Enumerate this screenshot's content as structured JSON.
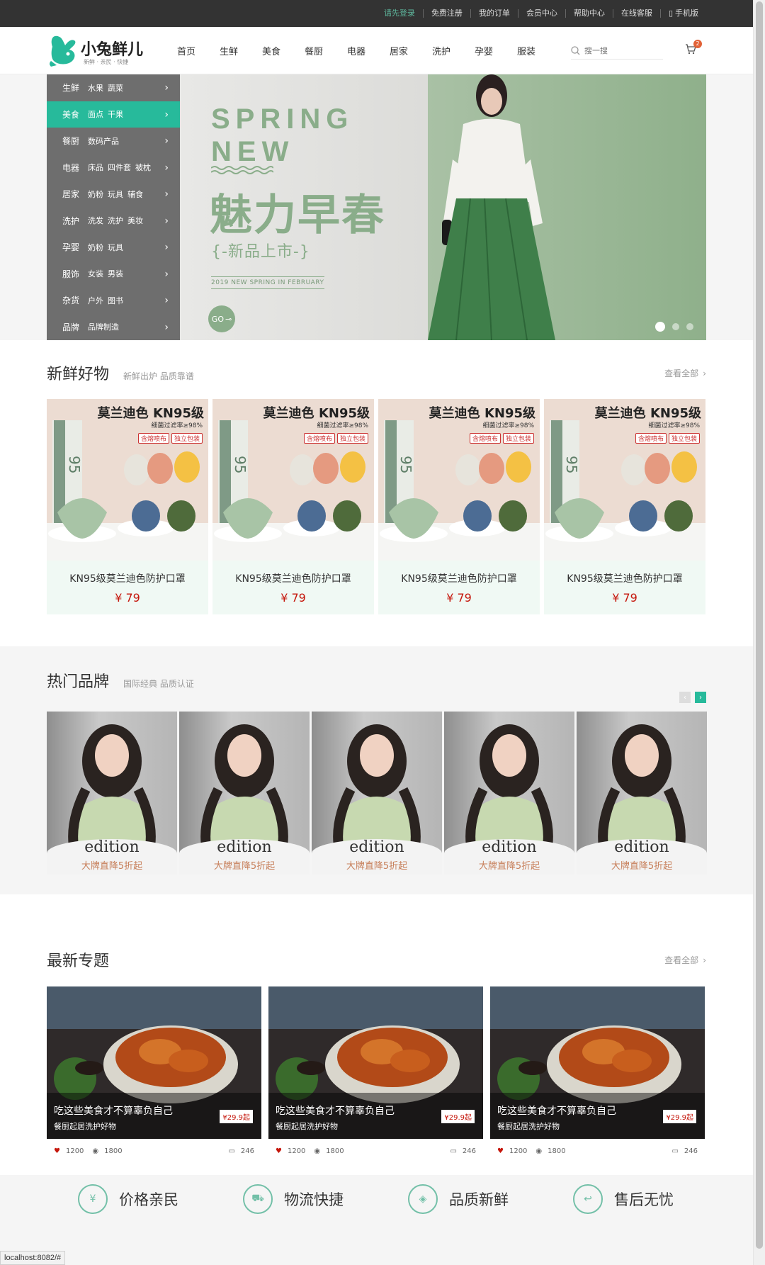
{
  "topbar": {
    "links": [
      {
        "label": "请先登录"
      },
      {
        "label": "免费注册"
      },
      {
        "label": "我的订单"
      },
      {
        "label": "会员中心"
      },
      {
        "label": "帮助中心"
      },
      {
        "label": "在线客服"
      },
      {
        "label": "手机版"
      }
    ]
  },
  "header": {
    "logo_text": "小兔鲜儿",
    "logo_slogan": "新鲜 · 亲民 · 快捷",
    "nav": [
      "首页",
      "生鲜",
      "美食",
      "餐厨",
      "电器",
      "居家",
      "洗护",
      "孕婴",
      "服装"
    ],
    "search_placeholder": "搜一搜",
    "cart_count": "2"
  },
  "categories": [
    {
      "main": "生鲜",
      "subs": [
        "水果",
        "蔬菜"
      ]
    },
    {
      "main": "美食",
      "subs": [
        "面点",
        "干果"
      ]
    },
    {
      "main": "餐厨",
      "subs": [
        "数码产品"
      ]
    },
    {
      "main": "电器",
      "subs": [
        "床品",
        "四件套",
        "被枕"
      ]
    },
    {
      "main": "居家",
      "subs": [
        "奶粉",
        "玩具",
        "辅食"
      ]
    },
    {
      "main": "洗护",
      "subs": [
        "洗发",
        "洗护",
        "美妆"
      ]
    },
    {
      "main": "孕婴",
      "subs": [
        "奶粉",
        "玩具"
      ]
    },
    {
      "main": "服饰",
      "subs": [
        "女装",
        "男装"
      ]
    },
    {
      "main": "杂货",
      "subs": [
        "户外",
        "图书"
      ]
    },
    {
      "main": "品牌",
      "subs": [
        "品牌制造"
      ]
    }
  ],
  "banner": {
    "line1": "SPRING",
    "line2": "NEW",
    "headline": "魅力早春",
    "tagline": "{-新品上市-}",
    "small": "2019 NEW SPRING IN FEBRUARY",
    "go": "GO"
  },
  "fresh": {
    "title": "新鲜好物",
    "subtitle": "新鲜出炉 品质靠谱",
    "more": "查看全部",
    "product_img_title": "莫兰迪色 KN95级",
    "product_img_sub": "细菌过滤率≥98%",
    "product_img_tag1": "含熔喷布",
    "product_img_tag2": "独立包装",
    "items": [
      {
        "name": "KN95级莫兰迪色防护口罩",
        "price": "¥ 79"
      },
      {
        "name": "KN95级莫兰迪色防护口罩",
        "price": "¥ 79"
      },
      {
        "name": "KN95级莫兰迪色防护口罩",
        "price": "¥ 79"
      },
      {
        "name": "KN95级莫兰迪色防护口罩",
        "price": "¥ 79"
      }
    ]
  },
  "brands": {
    "title": "热门品牌",
    "subtitle": "国际经典 品质认证",
    "items": [
      {
        "logo": "edition",
        "tag": "大牌直降5折起"
      },
      {
        "logo": "edition",
        "tag": "大牌直降5折起"
      },
      {
        "logo": "edition",
        "tag": "大牌直降5折起"
      },
      {
        "logo": "edition",
        "tag": "大牌直降5折起"
      },
      {
        "logo": "edition",
        "tag": "大牌直降5折起"
      }
    ]
  },
  "topics": {
    "title": "最新专题",
    "more": "查看全部",
    "items": [
      {
        "title": "吃这些美食才不算辜负自己",
        "sub": "餐厨起居洗护好物",
        "price": "¥29.9起",
        "likes": "1200",
        "views": "1800",
        "comments": "246"
      },
      {
        "title": "吃这些美食才不算辜负自己",
        "sub": "餐厨起居洗护好物",
        "price": "¥29.9起",
        "likes": "1200",
        "views": "1800",
        "comments": "246"
      },
      {
        "title": "吃这些美食才不算辜负自己",
        "sub": "餐厨起居洗护好物",
        "price": "¥29.9起",
        "likes": "1200",
        "views": "1800",
        "comments": "246"
      }
    ]
  },
  "service": [
    {
      "icon": "yen-icon",
      "label": "价格亲民"
    },
    {
      "icon": "truck-icon",
      "label": "物流快捷"
    },
    {
      "icon": "badge-icon",
      "label": "品质新鲜"
    },
    {
      "icon": "return-icon",
      "label": "售后无忧"
    }
  ],
  "status_url": "localhost:8082/#",
  "colors": {
    "accent": "#27ba9b",
    "price": "#c5160b",
    "topbar": "#333333"
  }
}
